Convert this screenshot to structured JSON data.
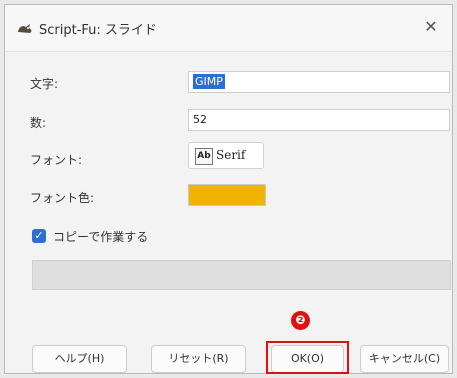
{
  "window": {
    "title": "Script-Fu: スライド",
    "close_glyph": "✕",
    "app_icon": "gimp-wilber-icon"
  },
  "form": {
    "text_label": "文字:",
    "text_value": "GIMP",
    "count_label": "数:",
    "count_value": "52",
    "font_label": "フォント:",
    "font_glyph": "Ab",
    "font_value": "Serif",
    "font_color_label": "フォント色:",
    "font_color": "#f0b400",
    "copy_checkbox_label": "コピーで作業する",
    "copy_checked": true,
    "progress_fraction": 0
  },
  "buttons": {
    "help": "ヘルプ(H)",
    "reset": "リセット(R)",
    "ok": "OK(O)",
    "cancel": "キャンセル(C)"
  },
  "annotation": {
    "marker": "❷",
    "color": "#e01010"
  }
}
